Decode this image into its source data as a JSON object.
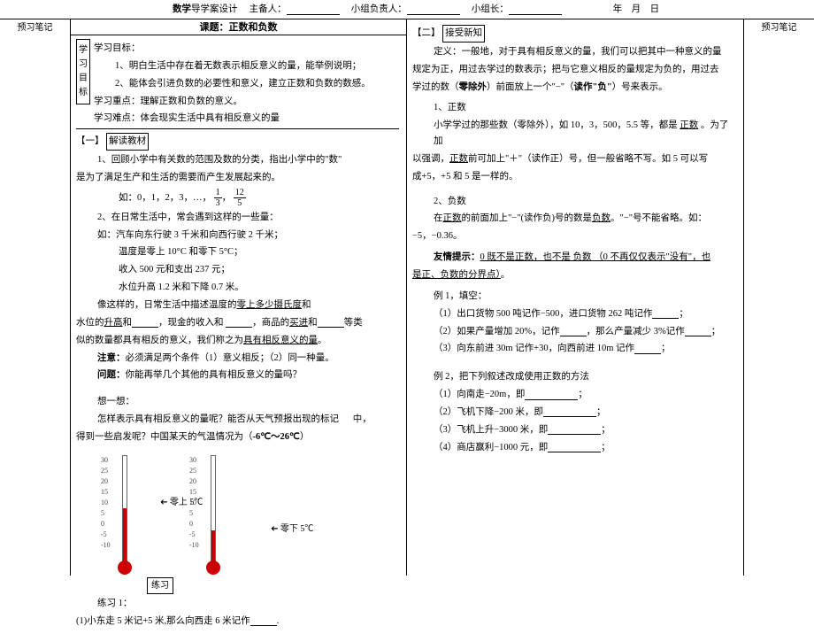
{
  "header": {
    "title_prefix": "数学",
    "title_rest": "导学案设计",
    "host_label": "主备人：",
    "group_leader_label": "小组负责人：",
    "team_leader_label": "小组长：",
    "year_label": "年",
    "month_label": "月",
    "day_label": "日"
  },
  "side_label_left": "预习笔记",
  "side_label_right": "预习笔记",
  "lesson_title": "课题：正数和负数",
  "goals": {
    "vert_label": "学习目标",
    "heading": "学习目标：",
    "g1": "1、明白生活中存在着无数表示相反意义的量，能举例说明；",
    "g2": "2、能体会引进负数的必要性和意义，建立正数和负数的数感。",
    "focus": "学习重点：理解正数和负数的意义。",
    "difficulty": "学习难点：体会现实生活中具有相反意义的量"
  },
  "sec1": {
    "tag": "【一】",
    "tag_box": "解读教材",
    "p1a": "1、回顾小学中有关数的范围及数的分类，指出小学中的\"数\"",
    "p1b": "是为了满足生产和生活的需要而产生发展起来的。",
    "p2": "如：0，1，2，3，…，",
    "p3": "2、在日常生活中，常会遇到这样的一些量：",
    "p4": "如：汽车向东行驶 3 千米和向西行驶 2 千米；",
    "p5": "温度是零上 10°C 和零下 5°C；",
    "p6": "收入 500 元和支出 237 元；",
    "p7": "水位升高 1.2 米和下降 0.7 米。",
    "p8a": "像这样的，日常生活中描述温度的",
    "p8b": "零上多少摄氏度",
    "p8c": "和",
    "p9a": "水位的",
    "p9b": "升高",
    "p9c": "和",
    "p9d": "，现金的收入和",
    "p9e": "，商品的",
    "p9f": "买进",
    "p9g": "和",
    "p9h": "等类",
    "p10a": "似的数量都具有相反的意义，我们称之为",
    "p10b": "具有相反意义的量",
    "p10c": "。",
    "note_label": "注意：",
    "note": "必须满足两个条件（1）意义相反；（2）同一种量。",
    "q_label": "问题：",
    "q": "你能再举几个其他的具有相反意义的量吗？",
    "think": "想一想：",
    "think_q1": "怎样表示具有相反意义的量呢？能否从天气预报出现的标记",
    "think_q2": "中，",
    "think_q3": "得到一些启发呢？中国某天的气温情况为（",
    "think_temp": "-6℃～26℃",
    "think_q4": "）",
    "thermo_left": "零上 5℃",
    "thermo_right": "零下 5℃",
    "practice_label": "练习",
    "practice1": "练习 1：",
    "practice1_q": "(1)小东走 5 米记+5 米,那么向西走 6 米记作"
  },
  "sec2": {
    "tag": "【二】",
    "tag_box": "接受新知",
    "def1": "定义：一般地，对于具有相反意义的量，我们可以把其中一种意义的量",
    "def2": "规定为正，用过去学过的数表示；把与它意义相反的量规定为负的，用过去",
    "def3a": "学过的数（",
    "def3b": "零除外",
    "def3c": "）前面放上一个\"−\"（",
    "def3d": "读作\"负\"",
    "def3e": "）号来表示。",
    "h1": "1、正数",
    "p1a": "小学学过的那些数（零除外），如 10，3，500，5.5 等，都是",
    "p1b": "正数",
    "p1c": "。为了加",
    "p2a": "以强调，",
    "p2b": "正数",
    "p2c": "前可加上\"＋\"（读作正）号，但一般省略不写。如 5 可以写",
    "p3": "成+5，+5 和 5 是一样的。",
    "h2": "2、负数",
    "p4a": "在",
    "p4b": "正数",
    "p4c": "的前面加上\"−\"(读作负)号的数是",
    "p4d": "负数",
    "p4e": "。\"−\"号不能省略。如：",
    "p5": "−5，−0.36。",
    "tip_label": "友情提示：",
    "tip1a": "0 既不是",
    "tip1b": "正数",
    "tip1c": "，也不是",
    "tip1d": "负数",
    "tip1e": "（0 不再仅仅表示\"没有\"，也",
    "tip2": "是正、负数的分界点）",
    "ex1_label": "例 1，填空：",
    "ex1_1": "（1）出口货物 500 吨记作−500，进口货物 262 吨记作",
    "ex1_2a": "（2）如果产量增加 20%，记作",
    "ex1_2b": "，那么产量减少 3%记作",
    "ex1_3a": "（3）向东前进 30m 记作+30，向西前进 10m 记作",
    "ex2_label": "例 2，把下列叙述改成使用正数的方法",
    "ex2_1": "（1）向南走−20m，即",
    "ex2_2": "（2）飞机下降−200 米，即",
    "ex2_3": "（3）飞机上升−3000 米，即",
    "ex2_4": "（4）商店赢利−1000 元，即"
  },
  "fractions": {
    "f1n": "1",
    "f1d": "3",
    "f2n": "12",
    "f2d": "5"
  },
  "ticks": [
    "30",
    "25",
    "20",
    "15",
    "10",
    "5",
    "0",
    "-5",
    "-10"
  ]
}
